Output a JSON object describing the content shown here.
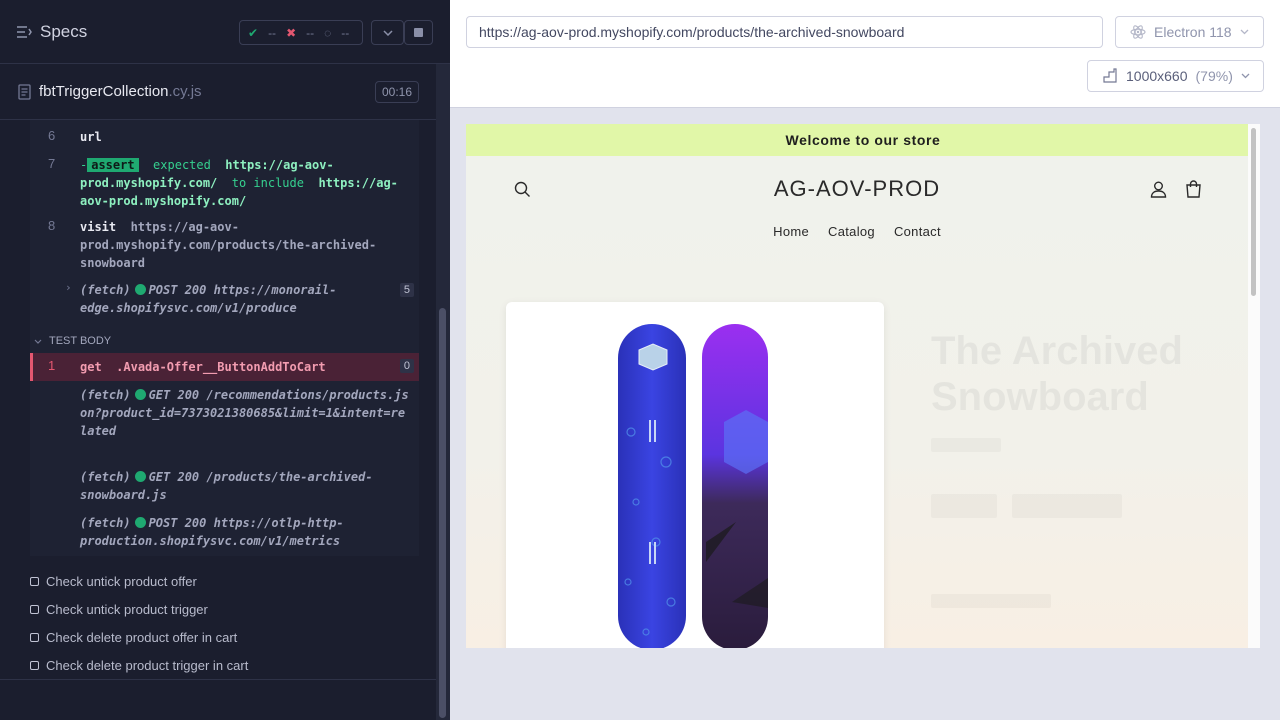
{
  "header": {
    "title": "Specs",
    "stats": {
      "passed": "--",
      "failed": "--",
      "pending": "--"
    }
  },
  "spec": {
    "name": "fbtTriggerCollection",
    "ext": ".cy.js",
    "duration": "00:16"
  },
  "log": {
    "c6": {
      "num": "6",
      "name": "url"
    },
    "c7": {
      "num": "7",
      "prefix": "-",
      "badge": "assert",
      "expected": "expected",
      "url1": "https://ag-aov-prod.myshopify.com/",
      "mid": "to include",
      "url2": "https://ag-aov-prod.myshopify.com/"
    },
    "c8": {
      "num": "8",
      "name": "visit",
      "url": "https://ag-aov-prod.myshopify.com/products/the-archived-snowboard"
    },
    "fetch1": {
      "label": "(fetch)",
      "text": "POST 200 https://monorail-edge.shopifysvc.com/v1/produce",
      "count": "5"
    },
    "section": "TEST BODY",
    "get": {
      "num": "1",
      "name": "get",
      "selector": ".Avada-Offer__ButtonAddToCart",
      "count": "0"
    },
    "fetch2": {
      "label": "(fetch)",
      "text": "GET 200 /recommendations/products.json?product_id=7373021380685&limit=1&intent=related"
    },
    "fetch3": {
      "label": "(fetch)",
      "text": "GET 200 /products/the-archived-snowboard.js"
    },
    "fetch4": {
      "label": "(fetch)",
      "text": "POST 200 https://otlp-http-production.shopifysvc.com/v1/metrics"
    }
  },
  "tests": [
    "Check untick product offer",
    "Check untick product trigger",
    "Check delete product offer in cart",
    "Check delete product trigger in cart"
  ],
  "browser_bar": {
    "url": "https://ag-aov-prod.myshopify.com/products/the-archived-snowboard",
    "browser": "Electron 118",
    "viewport": "1000x660",
    "scale": "(79%)"
  },
  "store": {
    "announcement": "Welcome to our store",
    "brand": "AG-AOV-PROD",
    "nav": [
      "Home",
      "Catalog",
      "Contact"
    ],
    "product_title": "The Archived Snowboard"
  },
  "colors": {
    "pass": "#1fa971",
    "fail": "#e45770",
    "announcement_bg": "#e1f7a8"
  }
}
